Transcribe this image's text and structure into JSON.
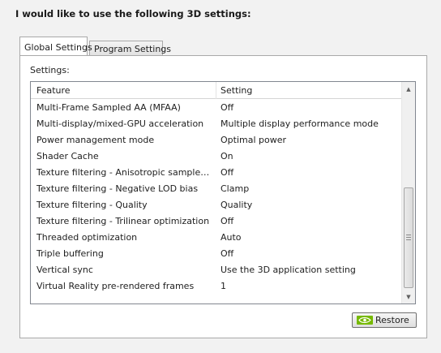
{
  "header": {
    "title": "I would like to use the following 3D settings:"
  },
  "tabs": [
    {
      "label": "Global Settings",
      "active": true
    },
    {
      "label": "Program Settings",
      "active": false
    }
  ],
  "panel": {
    "settings_label": "Settings:",
    "columns": {
      "feature": "Feature",
      "setting": "Setting"
    },
    "rows": [
      {
        "feature": "Multi-Frame Sampled AA (MFAA)",
        "setting": "Off"
      },
      {
        "feature": "Multi-display/mixed-GPU acceleration",
        "setting": "Multiple display performance mode"
      },
      {
        "feature": "Power management mode",
        "setting": "Optimal power"
      },
      {
        "feature": "Shader Cache",
        "setting": "On"
      },
      {
        "feature": "Texture filtering - Anisotropic sample opti...",
        "setting": "Off"
      },
      {
        "feature": "Texture filtering - Negative LOD bias",
        "setting": "Clamp"
      },
      {
        "feature": "Texture filtering - Quality",
        "setting": "Quality"
      },
      {
        "feature": "Texture filtering - Trilinear optimization",
        "setting": "Off"
      },
      {
        "feature": "Threaded optimization",
        "setting": "Auto"
      },
      {
        "feature": "Triple buffering",
        "setting": "Off"
      },
      {
        "feature": "Vertical sync",
        "setting": "Use the 3D application setting"
      },
      {
        "feature": "Virtual Reality pre-rendered frames",
        "setting": "1"
      }
    ],
    "restore_label": "Restore"
  },
  "icons": {
    "scroll_up": "chevron-up-icon",
    "scroll_down": "chevron-down-icon",
    "restore": "nvidia-logo-icon"
  },
  "colors": {
    "nvidia_green": "#76b900",
    "panel_bg": "#ffffff",
    "window_bg": "#f2f2f2"
  }
}
